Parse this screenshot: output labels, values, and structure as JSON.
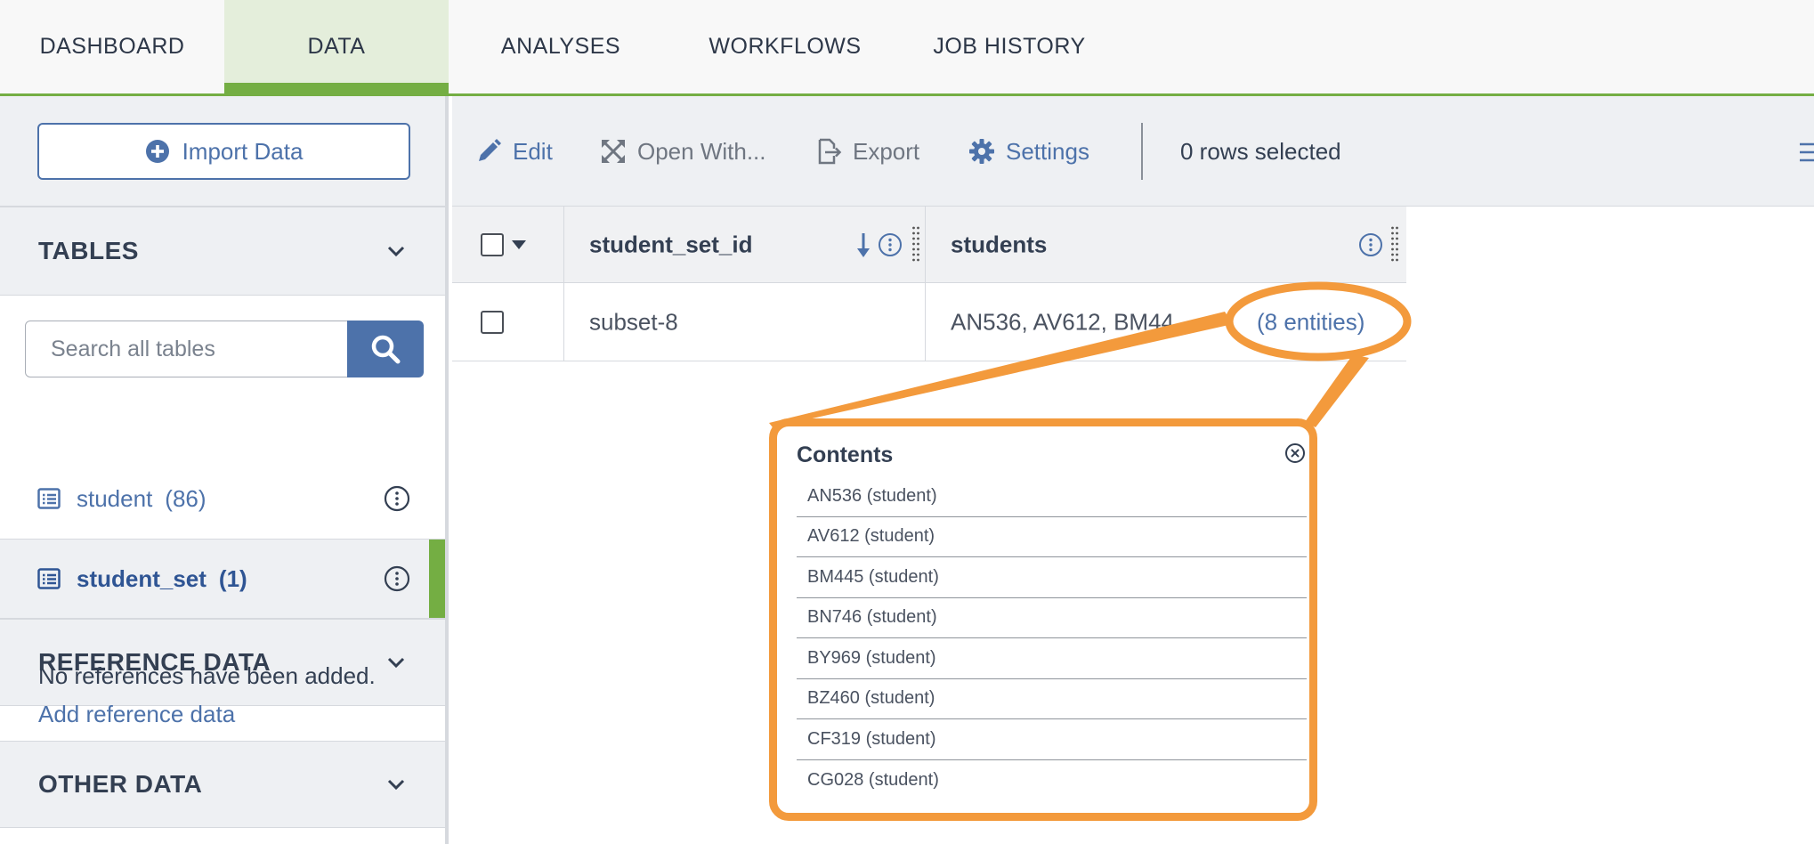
{
  "nav": {
    "tabs": [
      {
        "label": "DASHBOARD"
      },
      {
        "label": "DATA"
      },
      {
        "label": "ANALYSES"
      },
      {
        "label": "WORKFLOWS"
      },
      {
        "label": "JOB HISTORY"
      }
    ],
    "active_tab": "DATA"
  },
  "sidebar": {
    "import_label": "Import Data",
    "tables_header": "TABLES",
    "search_placeholder": "Search all tables",
    "tables": [
      {
        "name": "student",
        "count": "(86)"
      },
      {
        "name": "student_set",
        "count": "(1)"
      }
    ],
    "reference_header": "REFERENCE DATA",
    "reference_empty": "No references have been added.",
    "reference_add": "Add reference data",
    "other_header": "OTHER DATA"
  },
  "toolbar": {
    "edit": "Edit",
    "open_with": "Open With...",
    "export": "Export",
    "settings": "Settings",
    "rows_selected": "0 rows selected"
  },
  "grid": {
    "columns": [
      "student_set_id",
      "students"
    ],
    "rows": [
      {
        "student_set_id": "subset-8",
        "students_preview": "AN536,  AV612,  BM44",
        "entities_link": "(8 entities)"
      }
    ]
  },
  "popup": {
    "title": "Contents",
    "items": [
      "AN536 (student)",
      "AV612 (student)",
      "BM445 (student)",
      "BN746 (student)",
      "BY969 (student)",
      "BZ460 (student)",
      "CF319 (student)",
      "CG028 (student)"
    ]
  },
  "colors": {
    "accent_green": "#74ae43",
    "link_blue": "#4d72aa",
    "highlight_orange": "#f39a3c"
  }
}
